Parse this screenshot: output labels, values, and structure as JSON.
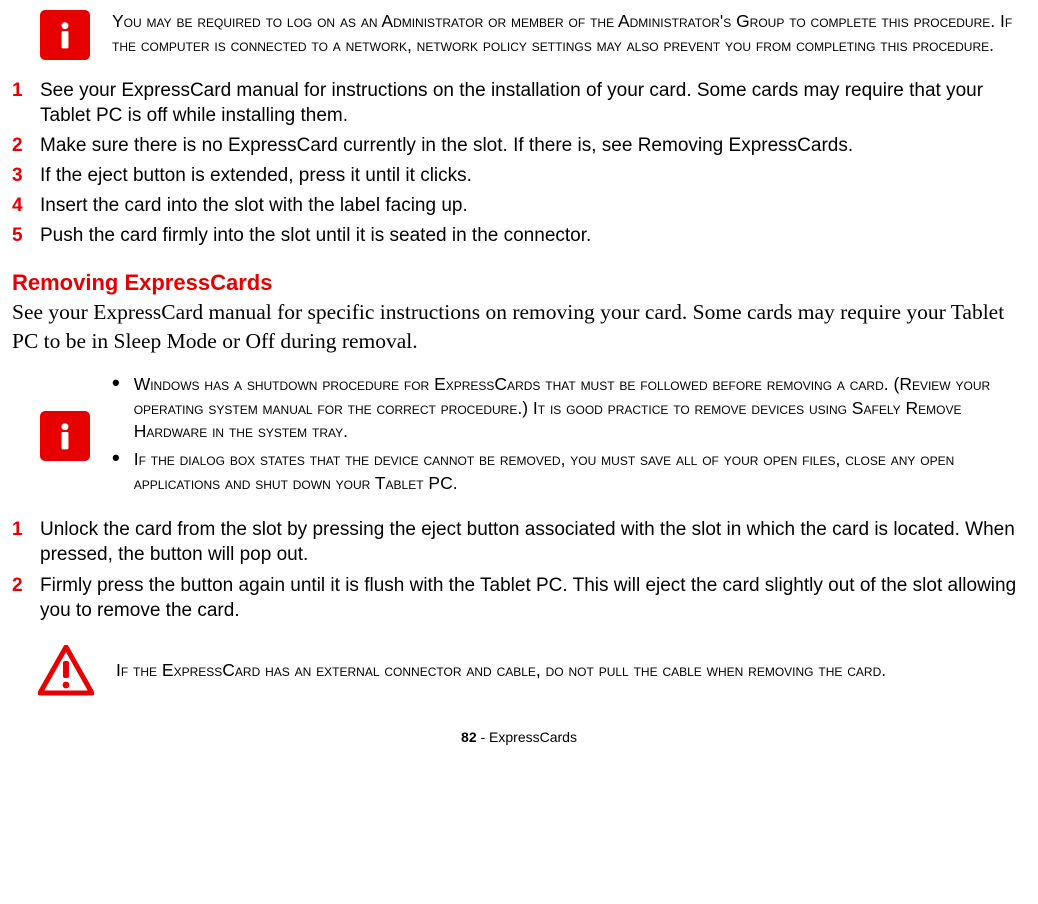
{
  "callout1": {
    "text": "You may be required to log on as an Administrator or member of the Administrator's Group to complete this procedure. If the computer is connected to a network, network policy settings may also prevent you from completing this procedure."
  },
  "installSteps": [
    "See your ExpressCard manual for instructions on the installation of your card. Some cards may require that your Tablet PC is off while installing them.",
    "Make sure there is no ExpressCard currently in the slot. If there is, see Removing ExpressCards.",
    "If the eject button is extended, press it until it clicks.",
    "Insert the card into the slot with the label facing up.",
    "Push the card firmly into the slot until it is seated in the connector."
  ],
  "section": {
    "heading": "Removing ExpressCards",
    "intro": "See your ExpressCard manual for specific instructions on removing your card. Some cards may require your Tablet PC to be in Sleep Mode or Off during removal."
  },
  "callout2": {
    "bullets": [
      "Windows has a shutdown procedure for ExpressCards that must be followed before removing a card. (Review your operating system manual for the correct procedure.) It is good practice to remove devices using Safely Remove Hardware in the system tray.",
      "If the dialog box states that the device cannot be removed, you must save all of your open files, close any open applications and shut down your Tablet PC."
    ]
  },
  "removeSteps": [
    "Unlock the card from the slot by pressing the eject button associated with the slot in which the card is located. When pressed, the button will pop out.",
    "Firmly press the button again until it is flush with the Tablet PC. This will eject the card slightly out of the slot allowing you to remove the card."
  ],
  "callout3": {
    "text": "If the ExpressCard has an external connector and cable, do not pull the cable when removing the card."
  },
  "footer": {
    "pageNum": "82",
    "pageTitle": " - ExpressCards"
  }
}
